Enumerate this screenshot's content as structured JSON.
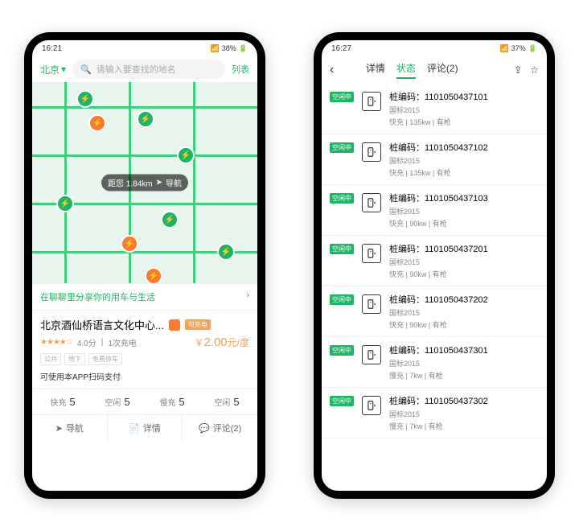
{
  "phoneA": {
    "status": {
      "time": "16:21",
      "battery": "38%"
    },
    "header": {
      "city": "北京",
      "searchPlaceholder": "请输入要查找的地名",
      "listBtn": "列表"
    },
    "map": {
      "distance": "距您 1.84km",
      "navBtn": "导航"
    },
    "share": {
      "text": "在聊聊里分享你的用车与生活",
      "arrow": "›"
    },
    "card": {
      "title": "北京酒仙桥语言文化中心...",
      "tagText": "可充电",
      "ratingText": "4.0分",
      "stars": "★★★★☆",
      "countTxt": "1次充电",
      "priceNum": "2.00",
      "priceUnit": "元/度",
      "priceSym": "￥",
      "chips": [
        "公共",
        "地下",
        "免费停车"
      ],
      "note": "可使用本APP扫码支付",
      "counts": [
        {
          "lbl": "快充",
          "val": "5"
        },
        {
          "lbl": "空闲",
          "val": "5"
        },
        {
          "lbl": "慢充",
          "val": "5"
        },
        {
          "lbl": "空闲",
          "val": "5"
        }
      ],
      "actions": {
        "nav": "导航",
        "detail": "详情",
        "comment": "评论(2)"
      }
    }
  },
  "phoneB": {
    "status": {
      "time": "16:27",
      "battery": "37%"
    },
    "tabs": {
      "t1": "详情",
      "t2": "状态",
      "t3": "评论(2)"
    },
    "badgeText": "空闲中",
    "items": [
      {
        "code": "桩编码：1101050437101",
        "std": "国标2015",
        "spec": "快充 | 135kw | 有枪"
      },
      {
        "code": "桩编码：1101050437102",
        "std": "国标2015",
        "spec": "快充 | 135kw | 有枪"
      },
      {
        "code": "桩编码：1101050437103",
        "std": "国标2015",
        "spec": "快充 | 90kw | 有枪"
      },
      {
        "code": "桩编码：1101050437201",
        "std": "国标2015",
        "spec": "快充 | 90kw | 有枪"
      },
      {
        "code": "桩编码：1101050437202",
        "std": "国标2015",
        "spec": "快充 | 90kw | 有枪"
      },
      {
        "code": "桩编码：1101050437301",
        "std": "国标2015",
        "spec": "慢充 | 7kw | 有枪"
      },
      {
        "code": "桩编码：1101050437302",
        "std": "国标2015",
        "spec": "慢充 | 7kw | 有枪"
      }
    ]
  }
}
